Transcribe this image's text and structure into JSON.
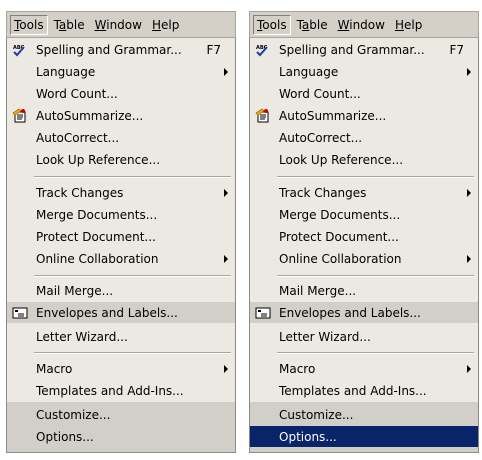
{
  "menubar": {
    "items": [
      {
        "label": "Tools",
        "active": true
      },
      {
        "label": "Table"
      },
      {
        "label": "Window"
      },
      {
        "label": "Help"
      }
    ]
  },
  "menu": {
    "spelling": {
      "label": "Spelling and Grammar...",
      "shortcut": "F7",
      "icon": "spelling-check-icon"
    },
    "language": {
      "label": "Language"
    },
    "word_count": {
      "label": "Word Count..."
    },
    "autosummarize": {
      "label": "AutoSummarize...",
      "icon": "autosummarize-icon"
    },
    "autocorrect": {
      "label": "AutoCorrect..."
    },
    "lookup": {
      "label": "Look Up Reference..."
    },
    "track_changes": {
      "label": "Track Changes"
    },
    "merge_documents": {
      "label": "Merge Documents..."
    },
    "protect_document": {
      "label": "Protect Document..."
    },
    "online_collab": {
      "label": "Online Collaboration"
    },
    "mail_merge": {
      "label": "Mail Merge..."
    },
    "envelopes": {
      "label": "Envelopes and Labels...",
      "icon": "envelope-icon"
    },
    "letter_wizard": {
      "label": "Letter Wizard..."
    },
    "macro": {
      "label": "Macro"
    },
    "templates": {
      "label": "Templates and Add-Ins..."
    },
    "customize": {
      "label": "Customize..."
    },
    "options": {
      "label": "Options..."
    }
  },
  "colors": {
    "menu_bg": "#ece9e2",
    "highlight_gray": "#d2cfc8",
    "selection_blue": "#0a246a"
  },
  "right_panel": {
    "selected_item": "Options..."
  }
}
